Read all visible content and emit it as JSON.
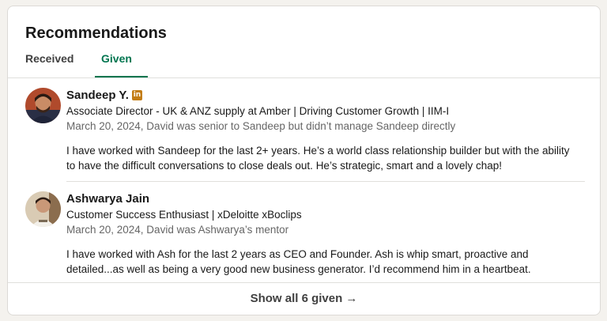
{
  "section": {
    "title": "Recommendations"
  },
  "tabs": [
    {
      "label": "Received",
      "active": false
    },
    {
      "label": "Given",
      "active": true
    }
  ],
  "recommendations": [
    {
      "name": "Sandeep Y.",
      "badge": "in",
      "headline": "Associate Director - UK & ANZ supply at Amber | Driving Customer Growth | IIM-I",
      "meta": "March 20, 2024, David was senior to Sandeep but didn’t manage Sandeep directly",
      "text": "I have worked with Sandeep for the last 2+ years. He’s a world class relationship builder but with the ability to have the difficult conversations to close deals out. He’s strategic, smart and a lovely chap!"
    },
    {
      "name": "Ashwarya Jain",
      "headline": "Customer Success Enthusiast | xDeloitte xBoclips",
      "meta": "March 20, 2024, David was Ashwarya’s mentor",
      "text": "I have worked with Ash for the last 2 years as CEO and Founder. Ash is whip smart, proactive and detailed...as well as being a very good new business generator. I’d recommend him in a heartbeat."
    }
  ],
  "footer": {
    "show_all": "Show all 6 given →"
  },
  "colors": {
    "accent": "#01754f",
    "linkedin_badge": "#c37d16"
  }
}
